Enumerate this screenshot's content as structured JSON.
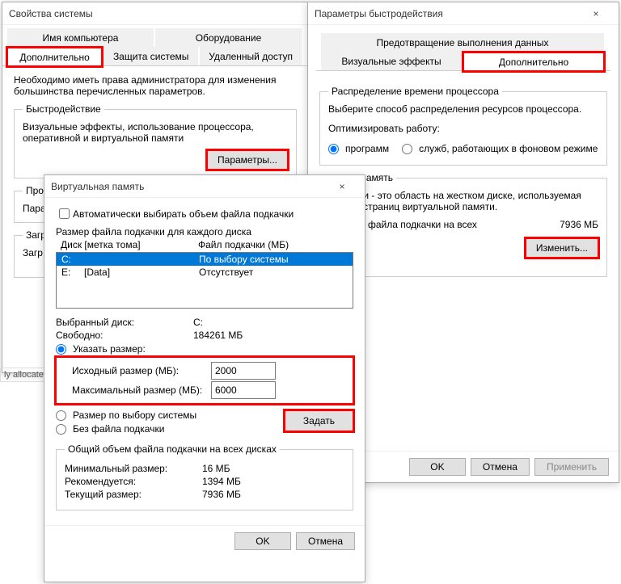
{
  "sys": {
    "title": "Свойства системы",
    "tabs": {
      "computer_name": "Имя компьютера",
      "hardware": "Оборудование",
      "advanced": "Дополнительно",
      "protection": "Защита системы",
      "remote": "Удаленный доступ"
    },
    "note": "Необходимо иметь права администратора для изменения большинства перечисленных параметров.",
    "perf": {
      "legend": "Быстродействие",
      "text": "Визуальные эффекты, использование процессора, оперативной и виртуальной памяти",
      "btn": "Параметры..."
    },
    "profiles": {
      "legend": "Профили пользователей",
      "text": "Пара"
    },
    "startup": {
      "legend": "Загр",
      "text": "Загр"
    }
  },
  "perfopt": {
    "title": "Параметры быстродействия",
    "close": "×",
    "tabs": {
      "visual": "Визуальные эффекты",
      "advanced": "Дополнительно",
      "dep": "Предотвращение выполнения данных"
    },
    "cpu": {
      "legend": "Распределение времени процессора",
      "text": "Выберите способ распределения ресурсов процессора.",
      "optlabel": "Оптимизировать работу:",
      "programs": "программ",
      "services": "служб, работающих в фоновом режиме"
    },
    "vm": {
      "legend": "льная память",
      "text1": "подкачки - это область на жестком диске, используемая",
      "text2": "анения страниц виртуальной памяти.",
      "totlabel": "й объем файла подкачки на всех",
      "totval": "7936 МБ",
      "btn": "Изменить..."
    },
    "ok": "OK",
    "cancel": "Отмена",
    "apply": "Применить"
  },
  "vm": {
    "title": "Виртуальная память",
    "close": "×",
    "auto": "Автоматически выбирать объем файла подкачки",
    "perdisk": "Размер файла подкачки для каждого диска",
    "col_disk": "Диск [метка тома]",
    "col_pf": "Файл подкачки (МБ)",
    "drives": [
      {
        "label": "C:",
        "pf": "По выбору системы",
        "sel": true
      },
      {
        "label": "E:     [Data]",
        "pf": "Отсутствует",
        "sel": false
      }
    ],
    "seldisk_l": "Выбранный диск:",
    "seldisk_v": "C:",
    "free_l": "Свободно:",
    "free_v": "184261 МБ",
    "r_custom": "Указать размер:",
    "init_l": "Исходный размер (МБ):",
    "init_v": "2000",
    "max_l": "Максимальный размер (МБ):",
    "max_v": "6000",
    "r_system": "Размер по выбору системы",
    "r_none": "Без файла подкачки",
    "set": "Задать",
    "total_legend": "Общий объем файла подкачки на всех дисках",
    "min_l": "Минимальный размер:",
    "min_v": "16 МБ",
    "rec_l": "Рекомендуется:",
    "rec_v": "1394 МБ",
    "cur_l": "Текущий размер:",
    "cur_v": "7936 МБ",
    "ok": "OK",
    "cancel": "Отмена"
  },
  "bg_crop": "ly allocated"
}
